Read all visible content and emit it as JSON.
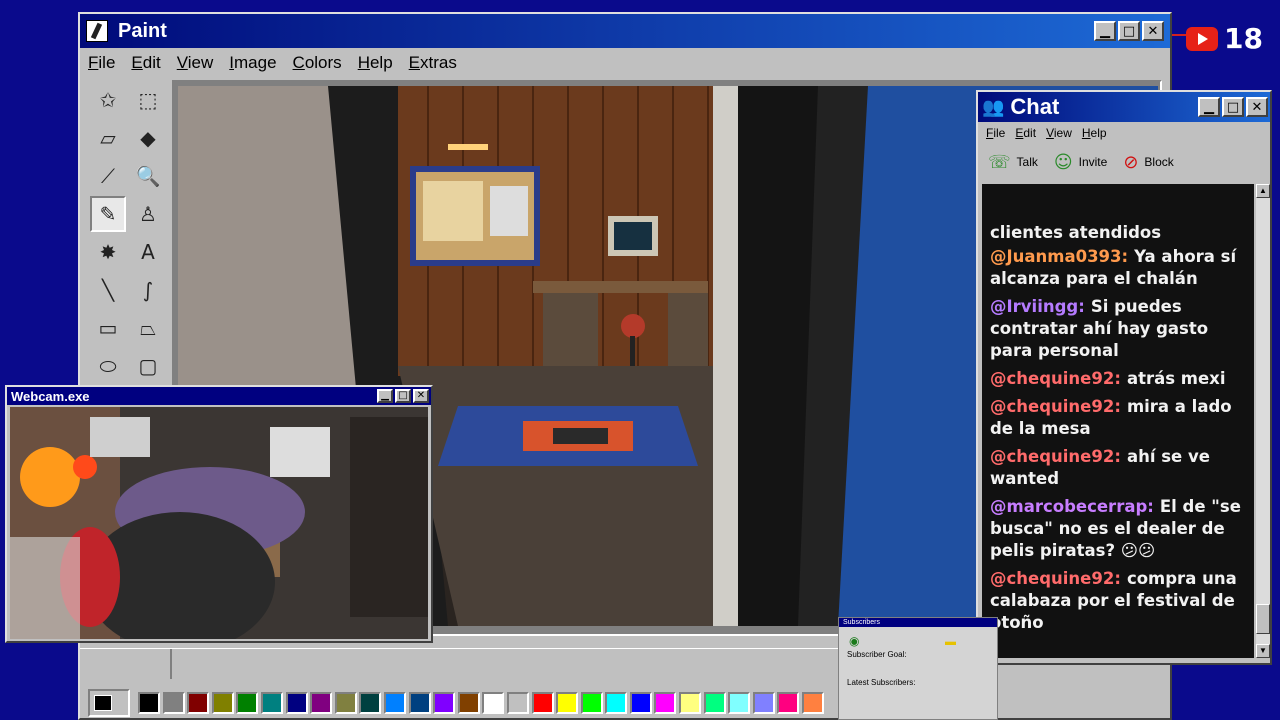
{
  "paint": {
    "title": "Paint",
    "menu": [
      "File",
      "Edit",
      "View",
      "Image",
      "Colors",
      "Help",
      "Extras"
    ],
    "tools": [
      {
        "name": "free-select-icon",
        "glyph": "✩"
      },
      {
        "name": "rect-select-icon",
        "glyph": "⬚"
      },
      {
        "name": "eraser-icon",
        "glyph": "▱"
      },
      {
        "name": "fill-icon",
        "glyph": "◆"
      },
      {
        "name": "color-picker-icon",
        "glyph": "⟋"
      },
      {
        "name": "magnifier-icon",
        "glyph": "🔍"
      },
      {
        "name": "pencil-icon",
        "glyph": "✎"
      },
      {
        "name": "brush-icon",
        "glyph": "♙"
      },
      {
        "name": "airbrush-icon",
        "glyph": "✸"
      },
      {
        "name": "text-icon",
        "glyph": "A"
      },
      {
        "name": "line-icon",
        "glyph": "╲"
      },
      {
        "name": "curve-icon",
        "glyph": "∫"
      },
      {
        "name": "rectangle-icon",
        "glyph": "▭"
      },
      {
        "name": "polygon-icon",
        "glyph": "⏢"
      },
      {
        "name": "ellipse-icon",
        "glyph": "⬭"
      },
      {
        "name": "rounded-rect-icon",
        "glyph": "▢"
      }
    ],
    "active_tool": "pencil-icon",
    "palette": [
      "#000000",
      "#808080",
      "#800000",
      "#808000",
      "#008000",
      "#008080",
      "#000080",
      "#800080",
      "#808040",
      "#004040",
      "#0080ff",
      "#004080",
      "#8000ff",
      "#804000",
      "#ffffff",
      "#c0c0c0",
      "#ff0000",
      "#ffff00",
      "#00ff00",
      "#00ffff",
      "#0000ff",
      "#ff00ff",
      "#ffff80",
      "#00ff80",
      "#80ffff",
      "#8080ff",
      "#ff0080",
      "#ff8040"
    ]
  },
  "webcam": {
    "title": "Webcam.exe"
  },
  "chat": {
    "title": "Chat",
    "menu": [
      "File",
      "Edit",
      "View",
      "Help"
    ],
    "actions": [
      {
        "label": "Talk",
        "icon": "talk-icon",
        "glyph": "☏",
        "color": "#2a8a2a"
      },
      {
        "label": "Invite",
        "icon": "invite-icon",
        "glyph": "☺",
        "color": "#2a8a2a"
      },
      {
        "label": "Block",
        "icon": "block-icon",
        "glyph": "⊘",
        "color": "#d01010"
      }
    ],
    "cutoff_text": "clientes atendidos",
    "messages": [
      {
        "user": "@Juanma0393:",
        "color": "#ff9a4d",
        "text": "Ya ahora sí alcanza para el chalán"
      },
      {
        "user": "@Irviingg:",
        "color": "#b57bff",
        "text": "Si puedes contratar ahí hay gasto para personal"
      },
      {
        "user": "@chequine92:",
        "color": "#ff6b6b",
        "text": "atrás mexi"
      },
      {
        "user": "@chequine92:",
        "color": "#ff6b6b",
        "text": "mira a lado de la mesa"
      },
      {
        "user": "@chequine92:",
        "color": "#ff6b6b",
        "text": "ahí se ve wanted"
      },
      {
        "user": "@marcobecerrap:",
        "color": "#c77dff",
        "text": "El de \"se busca\" no es el dealer de pelis piratas? 😕😕"
      },
      {
        "user": "@chequine92:",
        "color": "#ff6b6b",
        "text": "compra una calabaza por el festival de otoño"
      }
    ]
  },
  "subscribers": {
    "title": "Subscribers",
    "goal_label": "Subscriber Goal:",
    "latest_label": "Latest Subscribers:"
  },
  "youtube": {
    "count": "18"
  }
}
